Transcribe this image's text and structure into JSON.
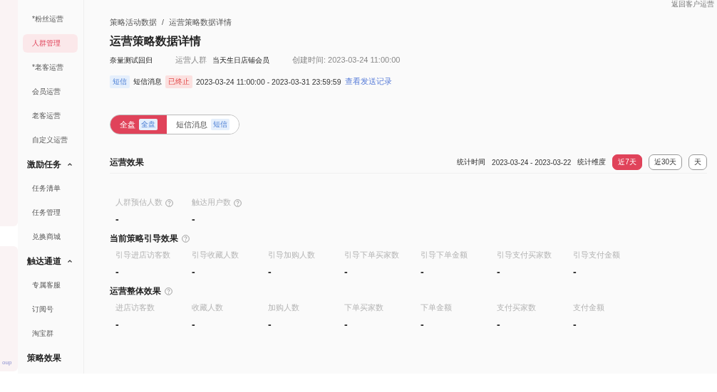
{
  "top_link": "返回客户运营",
  "edge_text": "oup",
  "sidebar": {
    "items": [
      {
        "label": "*粉丝运营",
        "kind": "item",
        "selected": false
      },
      {
        "label": "人群管理",
        "kind": "item",
        "selected": true
      },
      {
        "label": "*老客运营",
        "kind": "item",
        "selected": false
      },
      {
        "label": "会员运营",
        "kind": "item",
        "selected": false
      },
      {
        "label": "老客运营",
        "kind": "item",
        "selected": false
      },
      {
        "label": "自定义运营",
        "kind": "item",
        "selected": false
      },
      {
        "label": "激励任务",
        "kind": "group",
        "expanded": true,
        "children": [
          {
            "label": "任务清单",
            "kind": "item",
            "selected": false
          },
          {
            "label": "任务管理",
            "kind": "item",
            "selected": false
          },
          {
            "label": "兑换商城",
            "kind": "item",
            "selected": false
          }
        ]
      },
      {
        "label": "触达通道",
        "kind": "group",
        "expanded": true,
        "children": [
          {
            "label": "专属客服",
            "kind": "item",
            "selected": false
          },
          {
            "label": "订阅号",
            "kind": "item",
            "selected": false
          },
          {
            "label": "淘宝群",
            "kind": "item",
            "selected": false
          }
        ]
      },
      {
        "label": "策略效果",
        "kind": "section"
      }
    ]
  },
  "breadcrumb": [
    "策略活动数据",
    "运营策略数据详情"
  ],
  "breadcrumb_separator": "/",
  "title": "运营策略数据详情",
  "meta": {
    "name": "奈量测试回归",
    "audience_label": "运营人群",
    "audience": "当天生日店铺会员",
    "created": "创建时间: 2023-03-24 11:00:00"
  },
  "channel": {
    "tag": "短信",
    "name": "短信消息",
    "status": "已终止",
    "period": "2023-03-24 11:00:00 - 2023-03-31 23:59:59",
    "link": "查看发送记录"
  },
  "segments": [
    {
      "label": "全盘",
      "tag": "全盘",
      "selected": true
    },
    {
      "label": "短信消息",
      "tag": "短信",
      "selected": false
    }
  ],
  "effect": {
    "title": "运营效果",
    "time_label": "统计时间",
    "time_range": "2023-03-24 - 2023-03-22",
    "dimension_label": "统计维度",
    "ranges": [
      {
        "label": "近7天",
        "selected": true
      },
      {
        "label": "近30天",
        "selected": false
      },
      {
        "label": "天",
        "selected": false
      }
    ]
  },
  "metric_groups": [
    {
      "metrics": [
        {
          "label": "人群预估人数",
          "value": "-",
          "help": true
        },
        {
          "label": "触达用户数",
          "value": "-",
          "help": true
        }
      ]
    },
    {
      "title": "当前策略引导效果",
      "help": true,
      "metrics": [
        {
          "label": "引导进店访客数",
          "value": "-"
        },
        {
          "label": "引导收藏人数",
          "value": "-"
        },
        {
          "label": "引导加购人数",
          "value": "-"
        },
        {
          "label": "引导下单买家数",
          "value": "-"
        },
        {
          "label": "引导下单金额",
          "value": "-"
        },
        {
          "label": "引导支付买家数",
          "value": "-"
        },
        {
          "label": "引导支付金额",
          "value": "-"
        }
      ]
    },
    {
      "title": "运营整体效果",
      "help": true,
      "metrics": [
        {
          "label": "进店访客数",
          "value": "-"
        },
        {
          "label": "收藏人数",
          "value": "-"
        },
        {
          "label": "加购人数",
          "value": "-"
        },
        {
          "label": "下单买家数",
          "value": "-"
        },
        {
          "label": "下单金额",
          "value": "-"
        },
        {
          "label": "支付买家数",
          "value": "-"
        },
        {
          "label": "支付金额",
          "value": "-"
        }
      ]
    }
  ]
}
